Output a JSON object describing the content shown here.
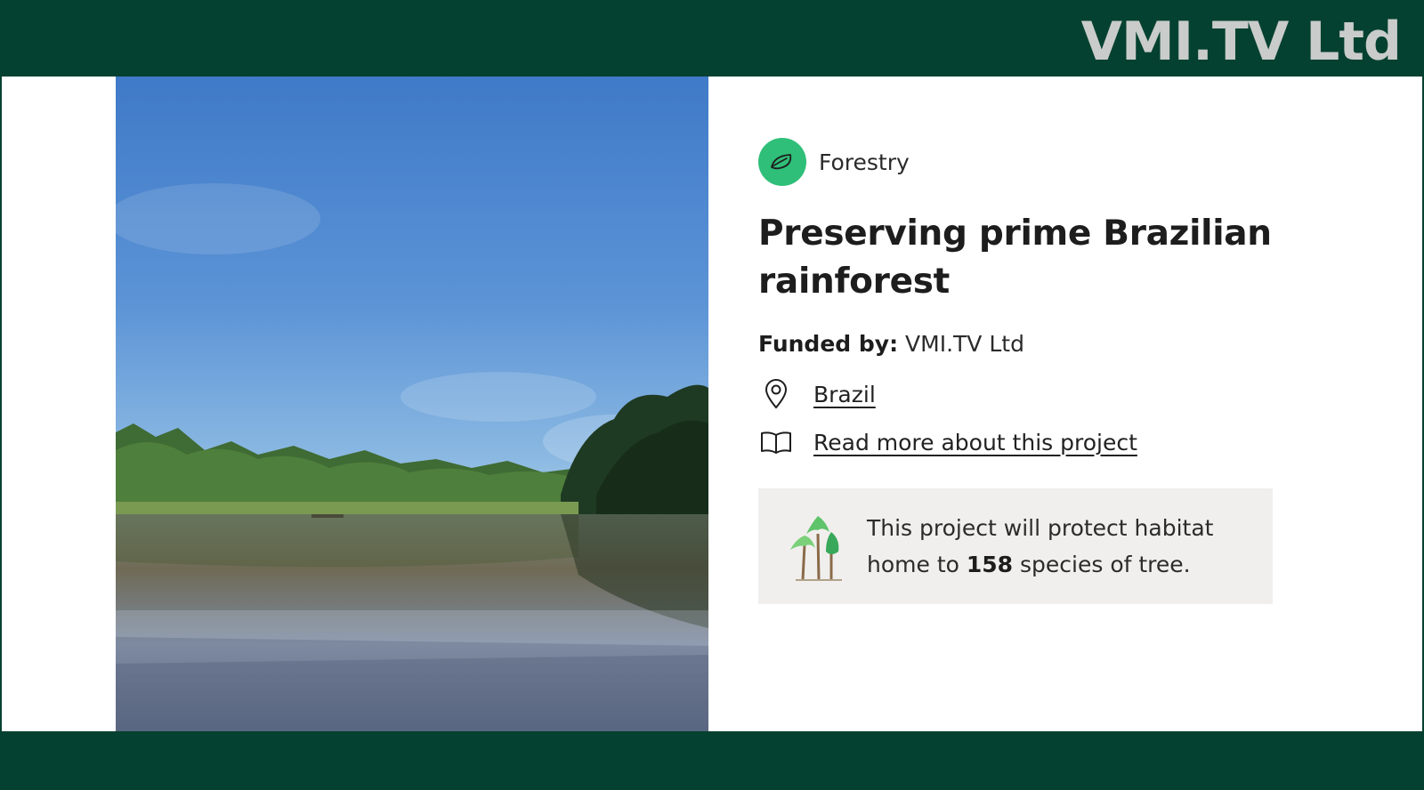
{
  "brand": {
    "name": "VMI.TV Ltd"
  },
  "category": {
    "label": "Forestry",
    "icon": "leaf-icon",
    "color": "#2fbf78"
  },
  "project": {
    "title": "Preserving prime Brazilian rainforest",
    "funded_label": "Funded by:",
    "funded_value": "VMI.TV Ltd",
    "location": "Brazil",
    "read_more": "Read more about this project"
  },
  "info": {
    "text_before": "This project will protect habitat home to",
    "species_count": "158",
    "text_after": "species of tree."
  },
  "colors": {
    "frame": "#054130",
    "info_bg": "#f0efed"
  }
}
